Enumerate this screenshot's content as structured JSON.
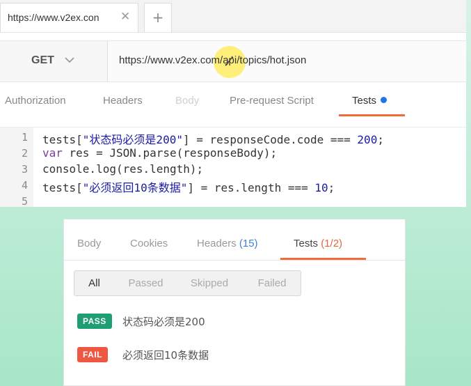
{
  "request_tab": {
    "title": "https://www.v2ex.con",
    "close_icon": "close-icon",
    "add_icon": "plus-icon"
  },
  "request": {
    "method": "GET",
    "url": "https://www.v2ex.com/api/topics/hot.json"
  },
  "request_tabs": [
    {
      "label": "Authorization",
      "state": "normal"
    },
    {
      "label": "Headers",
      "state": "normal"
    },
    {
      "label": "Body",
      "state": "disabled"
    },
    {
      "label": "Pre-request Script",
      "state": "normal"
    },
    {
      "label": "Tests",
      "state": "active"
    }
  ],
  "editor": {
    "line_numbers": [
      "1",
      "2",
      "3",
      "4",
      "5"
    ],
    "lines": [
      [
        {
          "t": "tests[",
          "c": ""
        },
        {
          "t": "\"状态码必须是200\"",
          "c": "str"
        },
        {
          "t": "] = responseCode.code === ",
          "c": ""
        },
        {
          "t": "200",
          "c": "num"
        },
        {
          "t": ";",
          "c": ""
        }
      ],
      [
        {
          "t": "var",
          "c": "kw"
        },
        {
          "t": " res = JSON.parse(responseBody);",
          "c": ""
        }
      ],
      [
        {
          "t": "console.log(res.length);",
          "c": ""
        }
      ],
      [
        {
          "t": "tests[",
          "c": ""
        },
        {
          "t": "\"必须返回10条数据\"",
          "c": "str"
        },
        {
          "t": "] = res.length === ",
          "c": ""
        },
        {
          "t": "10",
          "c": "num"
        },
        {
          "t": ";",
          "c": ""
        }
      ],
      []
    ]
  },
  "response_tabs": {
    "body": "Body",
    "cookies": "Cookies",
    "headers": "Headers",
    "headers_count": "(15)",
    "tests": "Tests",
    "tests_count": "(1/2)"
  },
  "filters": [
    "All",
    "Passed",
    "Skipped",
    "Failed"
  ],
  "results": [
    {
      "status": "PASS",
      "text": "状态码必须是200"
    },
    {
      "status": "FAIL",
      "text": "必须返回10条数据"
    }
  ],
  "colors": {
    "accent_orange": "#f26b3a",
    "pass_green": "#1f9d73",
    "fail_red": "#ee5842",
    "tests_dot_blue": "#1e74e8"
  }
}
